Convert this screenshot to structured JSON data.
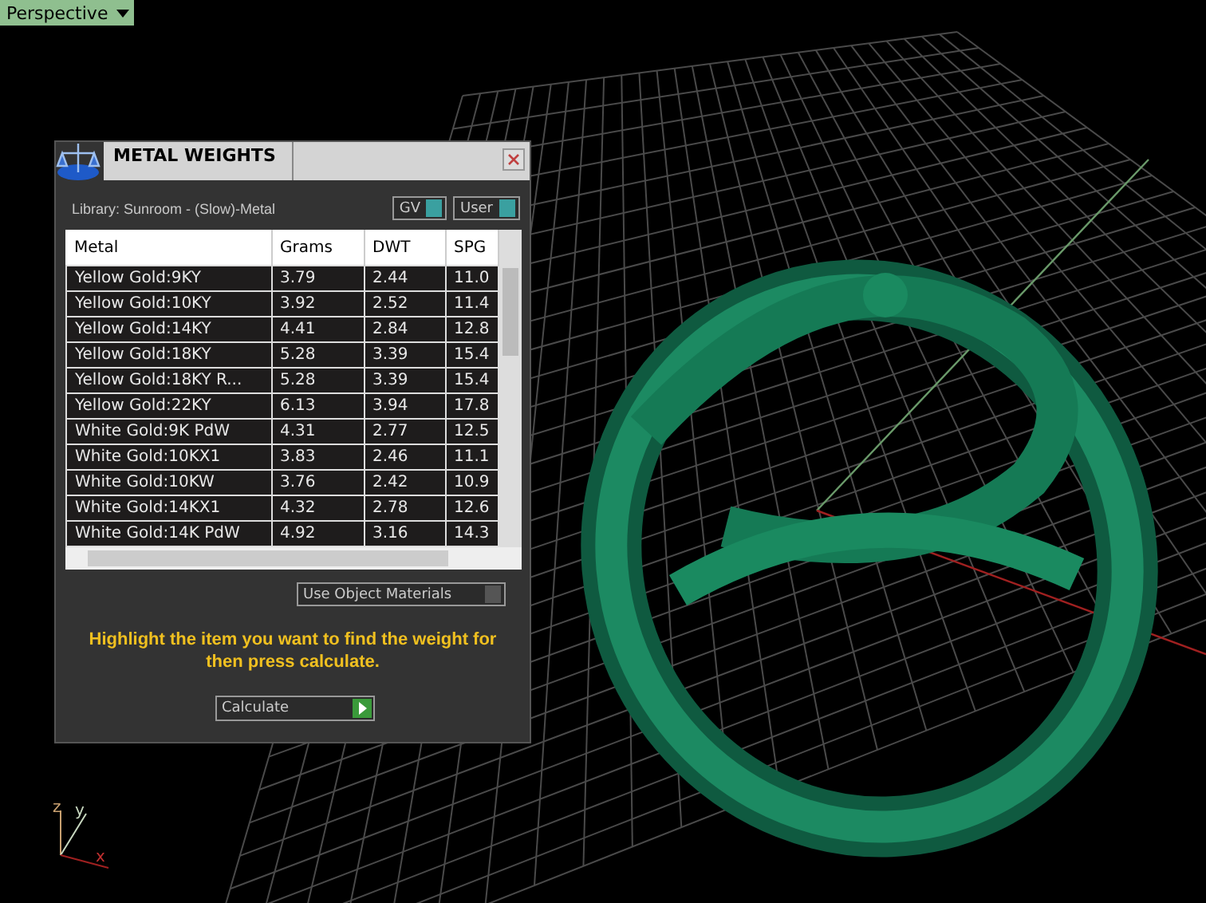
{
  "viewport": {
    "label": "Perspective",
    "axes": [
      "z",
      "y",
      "x"
    ]
  },
  "panel": {
    "title": "METAL WEIGHTS",
    "library": "Library: Sunroom - (Slow)-Metal",
    "toggles": [
      {
        "label": "GV",
        "on": true
      },
      {
        "label": "User",
        "on": true
      }
    ],
    "table": {
      "columns": [
        "Metal",
        "Grams",
        "DWT",
        "SPG"
      ],
      "rows": [
        {
          "cells": [
            "Yellow Gold:9KY",
            "3.79",
            "2.44",
            "11.0"
          ],
          "selected": false
        },
        {
          "cells": [
            "Yellow Gold:10KY",
            "3.92",
            "2.52",
            "11.4"
          ],
          "selected": false
        },
        {
          "cells": [
            "Yellow Gold:14KY",
            "4.41",
            "2.84",
            "12.8"
          ],
          "selected": false
        },
        {
          "cells": [
            "Yellow Gold:18KY",
            "5.28",
            "3.39",
            "15.4"
          ],
          "selected": false
        },
        {
          "cells": [
            "Yellow Gold:18KY R...",
            "5.28",
            "3.39",
            "15.4"
          ],
          "selected": false
        },
        {
          "cells": [
            "Yellow Gold:22KY",
            "6.13",
            "3.94",
            "17.8"
          ],
          "selected": false
        },
        {
          "cells": [
            "White Gold:9K PdW",
            "4.31",
            "2.77",
            "12.5"
          ],
          "selected": false
        },
        {
          "cells": [
            "White Gold:10KX1",
            "3.83",
            "2.46",
            "11.1"
          ],
          "selected": false
        },
        {
          "cells": [
            "White Gold:10KW",
            "3.76",
            "2.42",
            "10.9"
          ],
          "selected": false
        },
        {
          "cells": [
            "White Gold:14KX1",
            "4.32",
            "2.78",
            "12.6"
          ],
          "selected": false
        },
        {
          "cells": [
            "White Gold:14K PdW",
            "4.92",
            "3.16",
            "14.3"
          ],
          "selected": false
        }
      ]
    },
    "use_object_materials": {
      "label": "Use Object Materials",
      "on": false
    },
    "hint": "Highlight the item you want to find the weight for then press calculate.",
    "calculate_button": "Calculate"
  }
}
